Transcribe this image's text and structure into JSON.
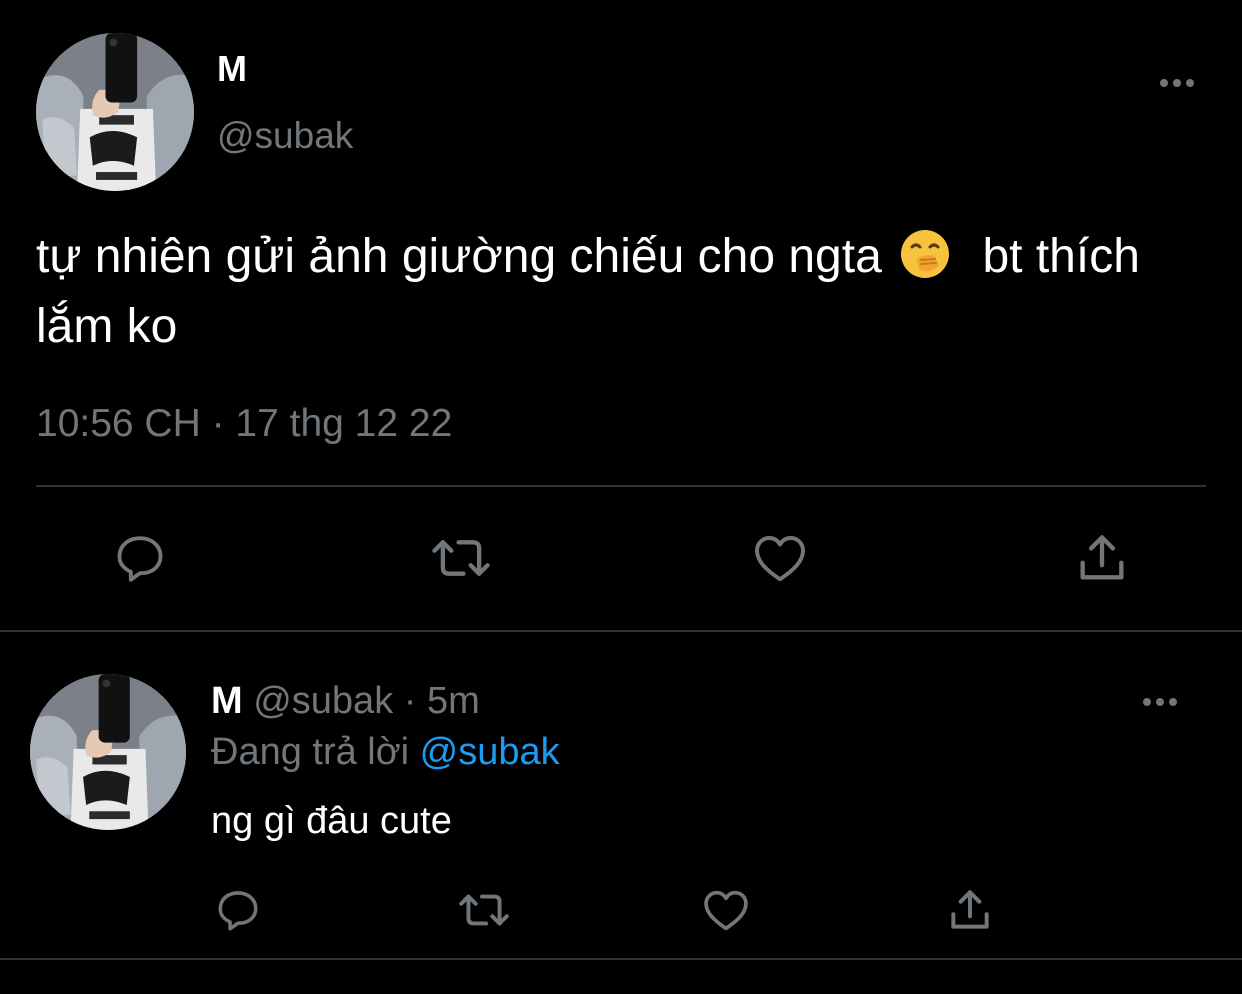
{
  "main_tweet": {
    "display_name": "M",
    "handle": "@subak",
    "text_before_emoji": "tự nhiên gửi ảnh giường chiếu cho ngta",
    "emoji": "hand-over-mouth-emoji",
    "text_after_emoji": "bt thích lắm ko",
    "timestamp": "10:56 CH · 17 thg 12 22",
    "actions": [
      "reply-icon",
      "retweet-icon",
      "like-icon",
      "share-icon"
    ]
  },
  "reply_tweet": {
    "display_name": "M",
    "handle": "@subak",
    "separator": "·",
    "age": "5m",
    "replying_prefix": "Đang trả lời",
    "replying_to": "@subak",
    "text": "ng gì đâu cute",
    "actions": [
      "reply-icon",
      "retweet-icon",
      "like-icon",
      "share-icon"
    ]
  },
  "colors": {
    "background": "#000000",
    "primary_text": "#ffffff",
    "secondary_text": "#71767b",
    "link": "#1d9bf0",
    "divider": "#2f3336"
  }
}
